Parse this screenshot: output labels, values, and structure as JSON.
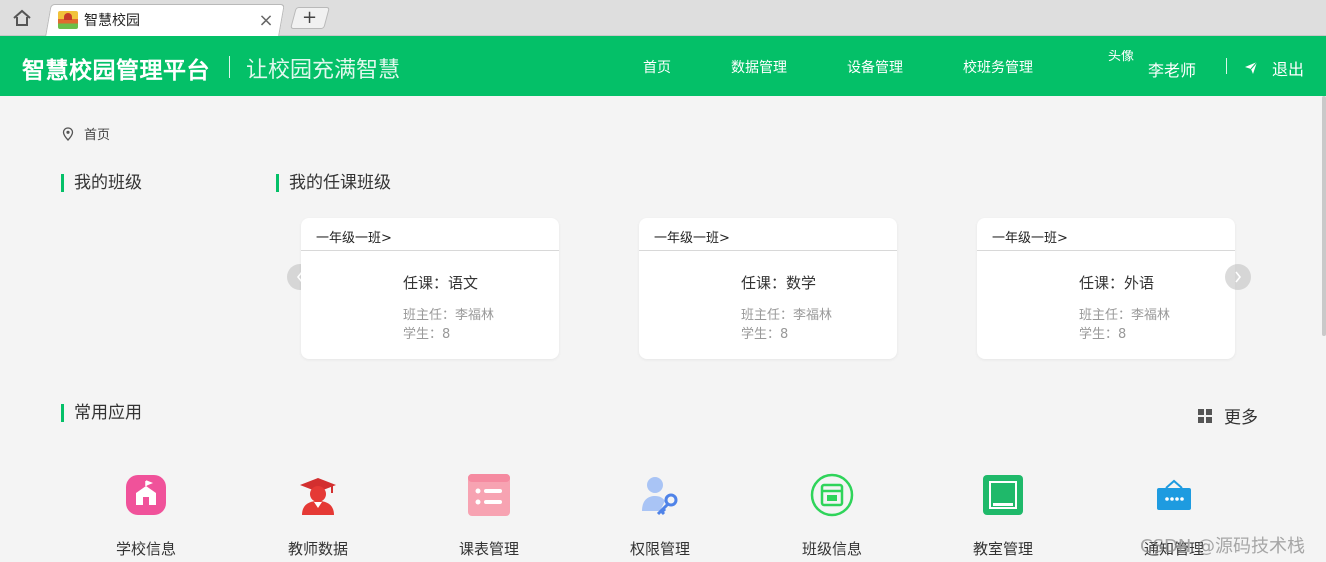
{
  "browser": {
    "tab_title": "智慧校园",
    "close_glyph": "×",
    "new_tab_glyph": "+"
  },
  "header": {
    "brand": "智慧校园管理平台",
    "slogan": "让校园充满智慧",
    "nav": [
      "首页",
      "数据管理",
      "设备管理",
      "校班务管理"
    ],
    "avatar_alt": "头像",
    "username": "李老师",
    "logout": "退出"
  },
  "breadcrumb": "首页",
  "sections": {
    "my_class": "我的班级",
    "teaching_classes": "我的任课班级",
    "common_apps": "常用应用",
    "more": "更多"
  },
  "cards": [
    {
      "class_name": "一年级一班>",
      "subject": "任课：语文",
      "head_teacher": "班主任：李福林",
      "students": "学生：8"
    },
    {
      "class_name": "一年级一班>",
      "subject": "任课：数学",
      "head_teacher": "班主任：李福林",
      "students": "学生：8"
    },
    {
      "class_name": "一年级一班>",
      "subject": "任课：外语",
      "head_teacher": "班主任：李福林",
      "students": "学生：8"
    }
  ],
  "apps": [
    {
      "label": "学校信息",
      "icon": "school-icon",
      "color": "#f0529a"
    },
    {
      "label": "教师数据",
      "icon": "teacher-icon",
      "color": "#e53935"
    },
    {
      "label": "课表管理",
      "icon": "schedule-icon",
      "color": "#f7a3b2"
    },
    {
      "label": "权限管理",
      "icon": "permission-icon",
      "color": "#6b9bf0"
    },
    {
      "label": "班级信息",
      "icon": "class-info-icon",
      "color": "#2fd45a"
    },
    {
      "label": "教室管理",
      "icon": "classroom-icon",
      "color": "#1fb96a"
    },
    {
      "label": "通知管理",
      "icon": "notice-icon",
      "color": "#1e9be0"
    }
  ],
  "watermark": "CSDN @源码技术栈",
  "colors": {
    "brand_green": "#04c068"
  }
}
